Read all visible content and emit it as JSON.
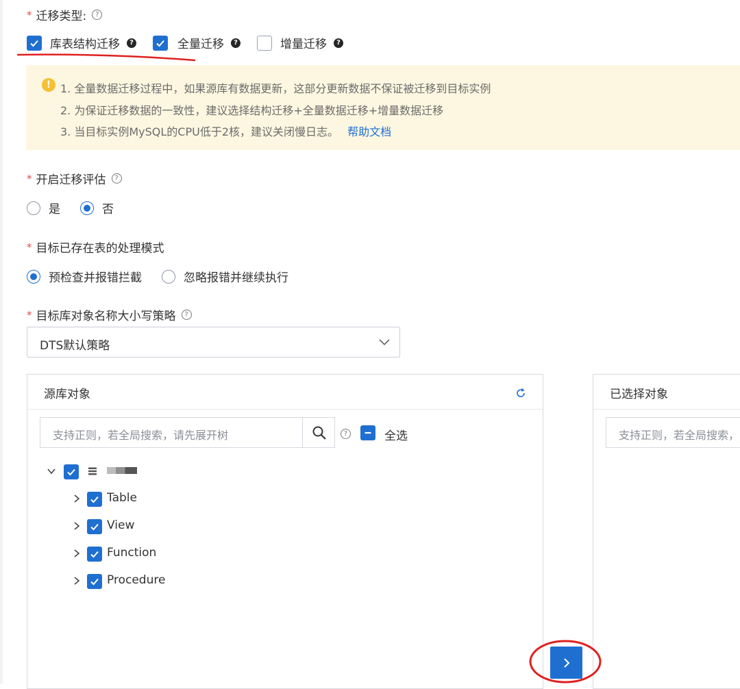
{
  "migration_type": {
    "label": "迁移类型:",
    "options": [
      {
        "label": "库表结构迁移",
        "checked": true
      },
      {
        "label": "全量迁移",
        "checked": true
      },
      {
        "label": "增量迁移",
        "checked": false
      }
    ]
  },
  "notice": {
    "lines": [
      "1. 全量数据迁移过程中，如果源库有数据更新，这部分更新数据不保证被迁移到目标实例",
      "2. 为保证迁移数据的一致性，建议选择结构迁移+全量数据迁移+增量数据迁移",
      "3. 当目标实例MySQL的CPU低于2核，建议关闭慢日志。"
    ],
    "link": "帮助文档"
  },
  "assessment": {
    "label": "开启迁移评估",
    "options": [
      {
        "label": "是",
        "selected": false
      },
      {
        "label": "否",
        "selected": true
      }
    ]
  },
  "existing_table_mode": {
    "label": "目标已存在表的处理模式",
    "options": [
      {
        "label": "预检查并报错拦截",
        "selected": true
      },
      {
        "label": "忽略报错并继续执行",
        "selected": false
      }
    ]
  },
  "case_policy": {
    "label": "目标库对象名称大小写策略",
    "value": "DTS默认策略"
  },
  "source_panel": {
    "title": "源库对象",
    "search_placeholder": "支持正则，若全局搜索，请先展开树",
    "select_all": "全选",
    "tree": [
      "Table",
      "View",
      "Function",
      "Procedure"
    ]
  },
  "selected_panel": {
    "title": "已选择对象",
    "search_placeholder": "支持正则，若全局搜索，"
  },
  "colors": {
    "accent": "#1f6fd1",
    "annotation_red": "#e02020",
    "notice_bg": "#fdf7e1"
  }
}
